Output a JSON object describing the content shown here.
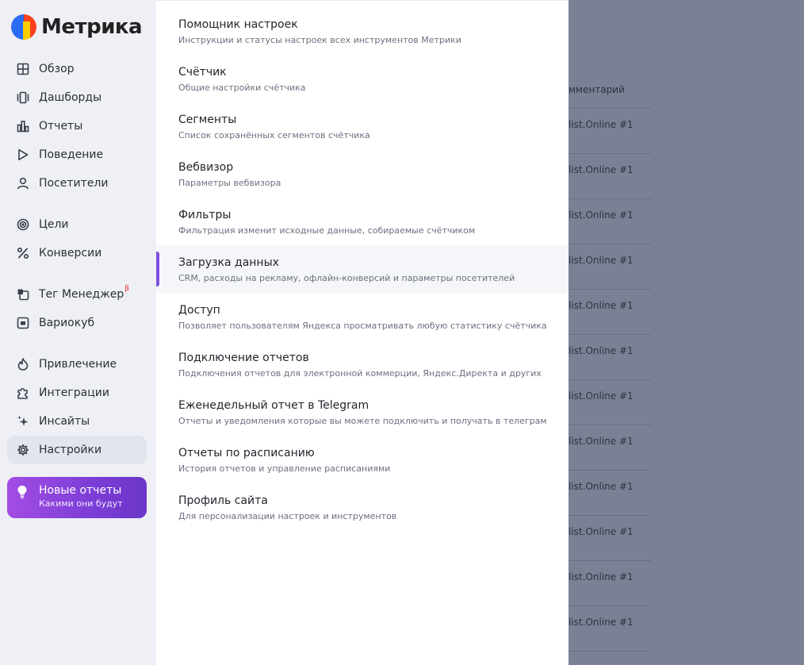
{
  "app": {
    "logo_text": "Метрика"
  },
  "sidebar": {
    "items": [
      {
        "label": "Обзор",
        "icon": "grid-icon"
      },
      {
        "label": "Дашборды",
        "icon": "dashboards-icon"
      },
      {
        "label": "Отчеты",
        "icon": "bar-chart-icon"
      },
      {
        "label": "Поведение",
        "icon": "play-icon"
      },
      {
        "label": "Посетители",
        "icon": "user-icon"
      },
      {
        "label": "Цели",
        "icon": "target-icon"
      },
      {
        "label": "Конверсии",
        "icon": "percent-icon"
      },
      {
        "label": "Тег Менеджер",
        "icon": "tag-manager-icon",
        "badge": "β"
      },
      {
        "label": "Вариокуб",
        "icon": "variocube-icon"
      },
      {
        "label": "Привлечение",
        "icon": "flame-icon"
      },
      {
        "label": "Интеграции",
        "icon": "puzzle-icon"
      },
      {
        "label": "Инсайты",
        "icon": "sparkle-icon"
      },
      {
        "label": "Настройки",
        "icon": "gear-icon",
        "active": true
      }
    ],
    "promo": {
      "title": "Новые отчеты",
      "subtitle": "Какими они будут",
      "icon": "lightbulb-icon"
    }
  },
  "settings_menu": {
    "items": [
      {
        "title": "Помощник настроек",
        "subtitle": "Инструкции и статусы настроек всех инструментов Метрики"
      },
      {
        "title": "Счётчик",
        "subtitle": "Общие настройки счётчика"
      },
      {
        "title": "Сегменты",
        "subtitle": "Список сохранённых сегментов счётчика"
      },
      {
        "title": "Вебвизор",
        "subtitle": "Параметры вебвизора"
      },
      {
        "title": "Фильтры",
        "subtitle": "Фильтрация изменит исходные данные, собираемые счётчиком"
      },
      {
        "title": "Загрузка данных",
        "subtitle": "CRM, расходы на рекламу, офлайн-конверсий и параметры посетителей",
        "selected": true
      },
      {
        "title": "Доступ",
        "subtitle": "Позволяет пользователям Яндекса просматривать любую статистику счётчика"
      },
      {
        "title": "Подключение отчетов",
        "subtitle": "Подключения отчетов для электронной коммерции, Яндекс.Директа и других"
      },
      {
        "title": "Еженедельный отчет в Telegram",
        "subtitle": "Отчеты и уведомления которые вы можете подключить и получать в телеграм"
      },
      {
        "title": "Отчеты по расписанию",
        "subtitle": "История отчетов и управление расписаниями"
      },
      {
        "title": "Профиль сайта",
        "subtitle": "Для персонализации настроек и инструментов"
      }
    ]
  },
  "background_table": {
    "header": "мментарий",
    "rows": [
      "list.Online #1",
      "list.Online #1",
      "list.Online #1",
      "list.Online #1",
      "list.Online #1",
      "list.Online #1",
      "list.Online #1",
      "list.Online #1",
      "list.Online #1",
      "list.Online #1",
      "list.Online #1",
      "list.Online #1"
    ]
  }
}
